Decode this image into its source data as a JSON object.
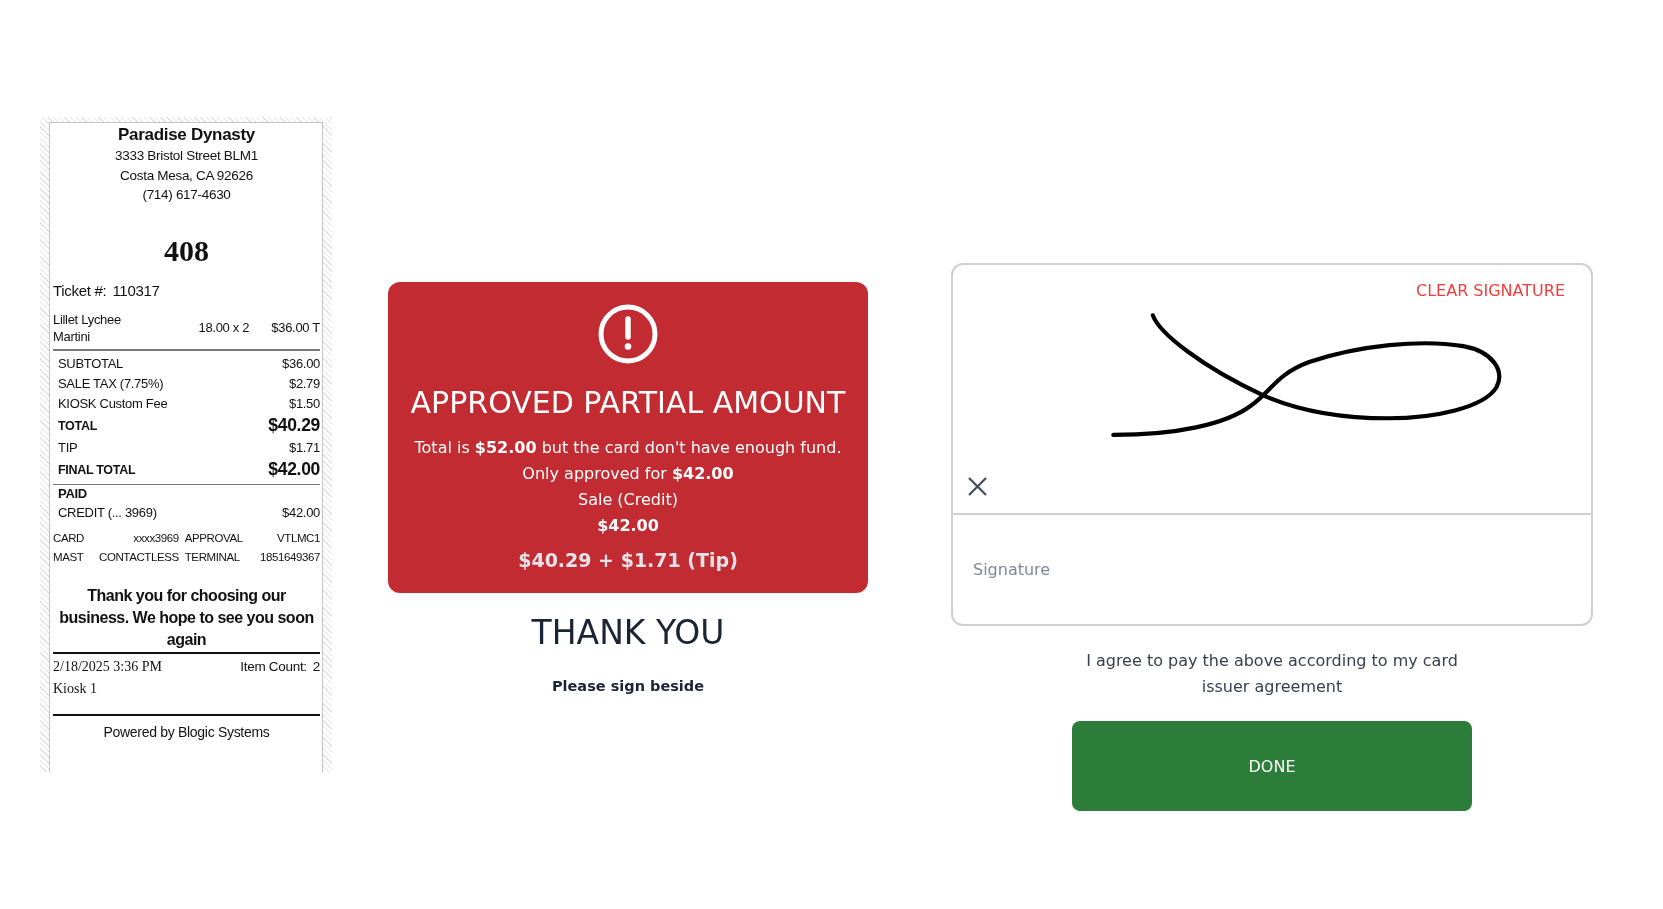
{
  "receipt": {
    "store_name": "Paradise Dynasty",
    "address_lines": [
      "3333 Bristol Street BLM1",
      "Costa Mesa, CA 92626",
      "(714) 617-4630"
    ],
    "order_number": "408",
    "ticket": {
      "label": "Ticket #:",
      "value": "110317"
    },
    "items": [
      {
        "name": "Lillet Lychee Martini",
        "quantity": "18.00 x 2",
        "amount": "$36.00 T"
      }
    ],
    "totals": [
      {
        "label": "SUBTOTAL",
        "value": "$36.00",
        "kind": "regular"
      },
      {
        "label": "SALE TAX (7.75%)",
        "value": "$2.79",
        "kind": "regular"
      },
      {
        "label": "KIOSK Custom Fee",
        "value": "$1.50",
        "kind": "regular"
      },
      {
        "label": "TOTAL",
        "value": "$40.29",
        "kind": "strong"
      },
      {
        "label": "TIP",
        "value": "$1.71",
        "kind": "regular"
      },
      {
        "label": "FINAL TOTAL",
        "value": "$42.00",
        "kind": "strong"
      }
    ],
    "payment": {
      "heading": "PAID",
      "rows": [
        {
          "label": "CREDIT (... 3969)",
          "value": "$42.00"
        }
      ]
    },
    "card_details": [
      {
        "column_1": "CARD",
        "column_2": "xxxx3969",
        "column_3": "APPROVAL",
        "column_4": "VTLMC1"
      },
      {
        "column_1": "MAST",
        "column_2": "CONTACTLESS",
        "column_3": "TERMINAL",
        "column_4": "1851649367"
      }
    ],
    "thank_you_message": "Thank you for choosing our business. We hope to see you soon again",
    "timestamp": "2/18/2025 3:36 PM",
    "item_count": {
      "label": "Item Count:",
      "value": "2"
    },
    "station": "Kiosk 1",
    "footer": "Powered by Blogic Systems"
  },
  "payment_alert": {
    "title": "APPROVED PARTIAL AMOUNT",
    "message_lines": [
      {
        "text": "Total is **$52.00** but the card don't have enough fund.",
        "kind": "plain"
      },
      {
        "text": "Only approved for **$42.00**",
        "kind": "plain"
      },
      {
        "text": "Sale (Credit)",
        "kind": "plain"
      },
      {
        "text": "$42.00",
        "kind": "strong"
      }
    ],
    "breakdown": "$40.29 + $1.71 (Tip)"
  },
  "thank_you": {
    "heading": "THANK YOU",
    "instruction": "Please sign beside"
  },
  "signature_pad": {
    "clear_label": "CLEAR SIGNATURE",
    "signed": true,
    "name_field": {
      "placeholder": "Signature"
    }
  },
  "agreement": "I agree to pay the above according to my card issuer agreement",
  "done_button": {
    "label": "DONE"
  }
}
